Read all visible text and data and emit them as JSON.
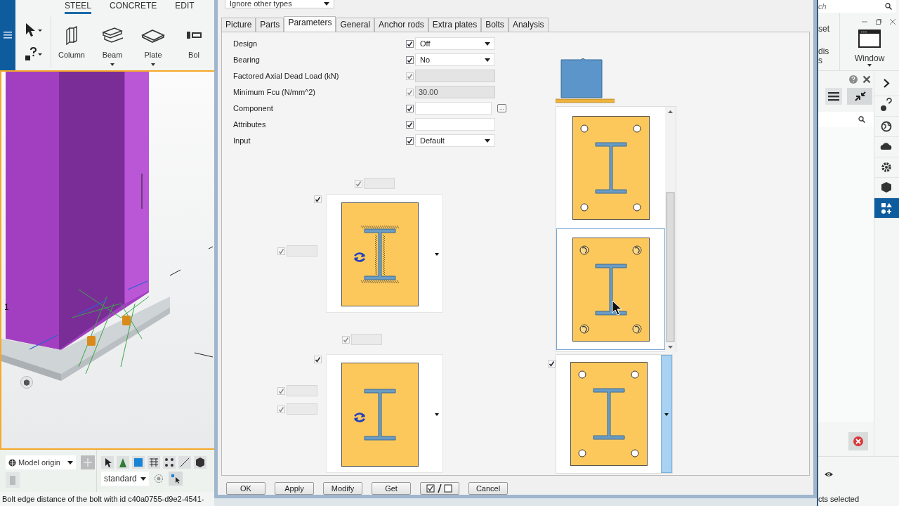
{
  "app": {
    "ribbon_tabs": [
      {
        "label": "STEEL",
        "selected": true
      },
      {
        "label": "CONCRETE",
        "selected": false
      },
      {
        "label": "EDIT",
        "selected": false
      }
    ],
    "ribbon_tools": [
      {
        "label": "Column",
        "has_menu": false
      },
      {
        "label": "Beam",
        "has_menu": true
      },
      {
        "label": "Plate",
        "has_menu": true
      },
      {
        "label": "Bol",
        "has_menu": false
      }
    ],
    "viewport": {
      "axis_label": "1"
    },
    "origin_dropdown": "Model origin",
    "view_dropdown": "standard",
    "status_text": "Bolt edge distance of the bolt with id c40a0755-d9e2-4541-",
    "search": {
      "placeholder": "ch"
    },
    "ribbon_labels": [
      "set",
      "dis",
      "s"
    ],
    "window_button": "Window",
    "side_tabs": [
      {
        "selected": false
      },
      {
        "selected": false
      },
      {
        "selected": false
      },
      {
        "selected": false
      },
      {
        "selected": false
      },
      {
        "selected": true
      }
    ],
    "right_status_text": "cts selected"
  },
  "dialog": {
    "filter_dropdown": "Ignore other types",
    "tabs": [
      {
        "label": "Picture",
        "selected": false
      },
      {
        "label": "Parts",
        "selected": false
      },
      {
        "label": "Parameters",
        "selected": true
      },
      {
        "label": "General",
        "selected": false
      },
      {
        "label": "Anchor rods",
        "selected": false
      },
      {
        "label": "Extra plates",
        "selected": false
      },
      {
        "label": "Bolts",
        "selected": false
      },
      {
        "label": "Analysis",
        "selected": false
      }
    ],
    "parameters": [
      {
        "label": "Design",
        "kind": "dropdown",
        "checked": true,
        "disabled": false,
        "value": "Off"
      },
      {
        "label": "Bearing",
        "kind": "dropdown",
        "checked": true,
        "disabled": false,
        "value": "No"
      },
      {
        "label": "Factored Axial Dead Load (kN)",
        "kind": "field",
        "checked": true,
        "disabled": true
      },
      {
        "label": "Minimum Fcu (N/mm^2)",
        "kind": "field",
        "checked": true,
        "disabled": true,
        "value": "30.00"
      },
      {
        "label": "Component",
        "kind": "browse",
        "checked": true,
        "disabled": false,
        "browse_label": "..."
      },
      {
        "label": "Attributes",
        "kind": "field",
        "checked": true,
        "disabled": false
      },
      {
        "label": "Input",
        "kind": "dropdown",
        "checked": true,
        "disabled": false,
        "value": "Default"
      }
    ],
    "option_fields": [
      {
        "checked": true,
        "disabled": true
      },
      {
        "checked": true,
        "disabled": true
      },
      {
        "checked": true,
        "disabled": true
      },
      {
        "checked": true,
        "disabled": true
      },
      {
        "checked": true,
        "disabled": true
      }
    ],
    "profile_pictures": [
      {
        "checked": true,
        "welded": true,
        "rotate": true
      },
      {
        "checked": true,
        "welded": false,
        "rotate": true
      }
    ],
    "plate_list": [
      {
        "kind": "round",
        "selected": false
      },
      {
        "kind": "bolt",
        "selected": true
      }
    ],
    "plate_select": {
      "checked": true,
      "kind": "round"
    },
    "buttons": [
      {
        "kind": "text",
        "label": "OK"
      },
      {
        "kind": "text",
        "label": "Apply"
      },
      {
        "kind": "text",
        "label": "Modify"
      },
      {
        "kind": "text",
        "label": "Get"
      },
      {
        "kind": "toggle"
      },
      {
        "kind": "text",
        "label": "Cancel"
      }
    ]
  }
}
